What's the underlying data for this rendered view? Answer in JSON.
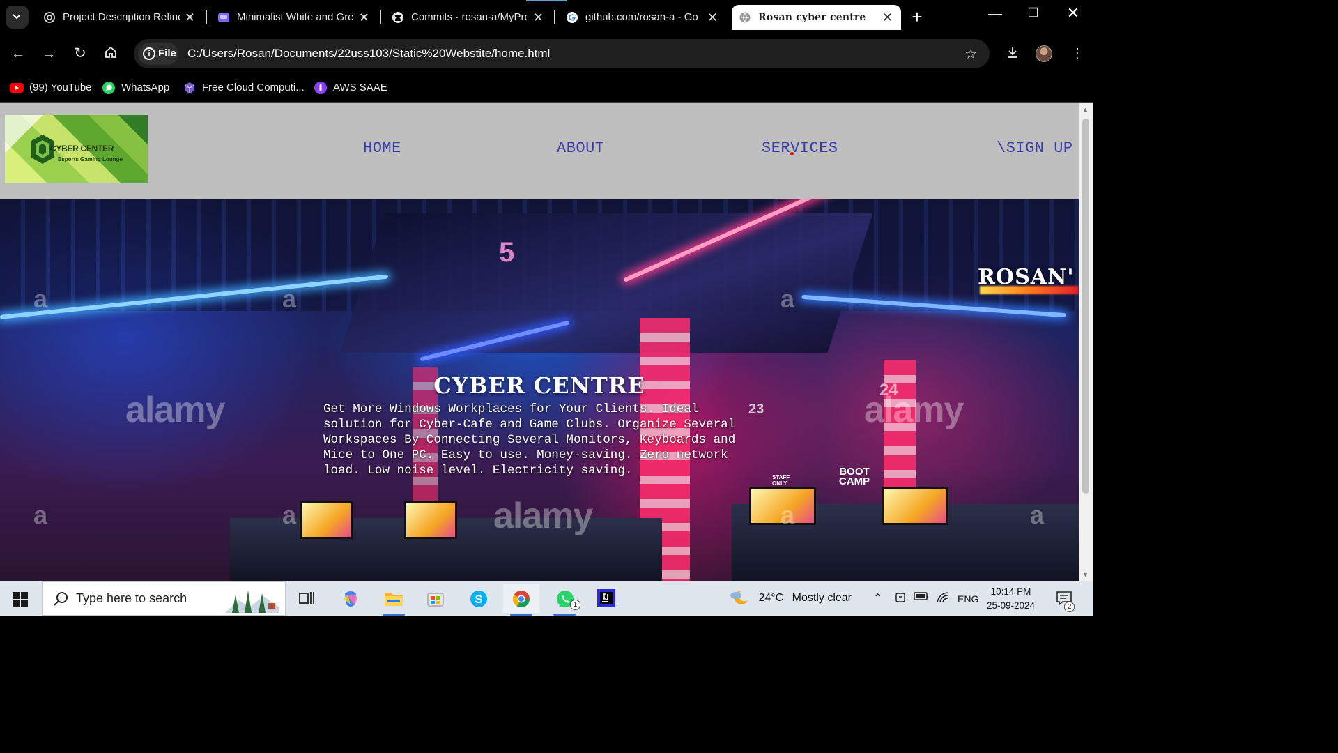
{
  "browser": {
    "tabs": [
      {
        "title": "Project Description Refine",
        "icon": "openai-icon"
      },
      {
        "title": "Minimalist White and Gre",
        "icon": "canva-icon"
      },
      {
        "title": "Commits · rosan-a/MyPro",
        "icon": "github-icon"
      },
      {
        "title": "github.com/rosan-a - Go",
        "icon": "google-icon"
      },
      {
        "title": "Rosan cyber centre",
        "icon": "globe-icon",
        "active": true
      }
    ],
    "address": {
      "scheme_label": "File",
      "url": "C:/Users/Rosan/Documents/22uss103/Static%20Webstite/home.html"
    },
    "bookmarks": [
      {
        "label": "(99) YouTube",
        "icon": "youtube-icon"
      },
      {
        "label": "WhatsApp",
        "icon": "whatsapp-icon"
      },
      {
        "label": "Free Cloud Computi...",
        "icon": "cube-icon"
      },
      {
        "label": "AWS SAAE",
        "icon": "aws-icon"
      }
    ]
  },
  "site": {
    "logo": {
      "line1": "CYBER CENTER",
      "line2": "Esports Gaming Lounge"
    },
    "nav": [
      "HOME",
      "ABOUT",
      "SERVICES",
      "\\SIGN UP"
    ],
    "banner_text": "ROSAN'",
    "hero": {
      "title": "CYBER CENTRE",
      "body": "Get More Windows Workplaces for Your Clients. Ideal solution for Cyber-Cafe and Game Clubs. Organize Several Workspaces By Connecting Several Monitors, Keyboards and Mice to One PC. Easy to use. Money-saving. Zero network load. Low noise level. Electricity saving."
    },
    "image_watermarks": [
      "a",
      "a",
      "a",
      "alamy",
      "alamy",
      "alamy",
      "a",
      "a",
      "a",
      "a"
    ],
    "scene_signs": [
      "5",
      "23",
      "24",
      "BOOT CAMP",
      "STAFF ONLY"
    ]
  },
  "taskbar": {
    "search_placeholder": "Type here to search",
    "weather": {
      "temp": "24°C",
      "condition": "Mostly clear"
    },
    "language": "ENG",
    "time": "10:14 PM",
    "date": "25-09-2024",
    "whatsapp_badge": "1",
    "notification_count": "2"
  },
  "colors": {
    "nav_link": "#3b3ba8",
    "header_bg": "#bebebe",
    "active_tab": "#ffffff",
    "chrome_bg": "#000000"
  }
}
